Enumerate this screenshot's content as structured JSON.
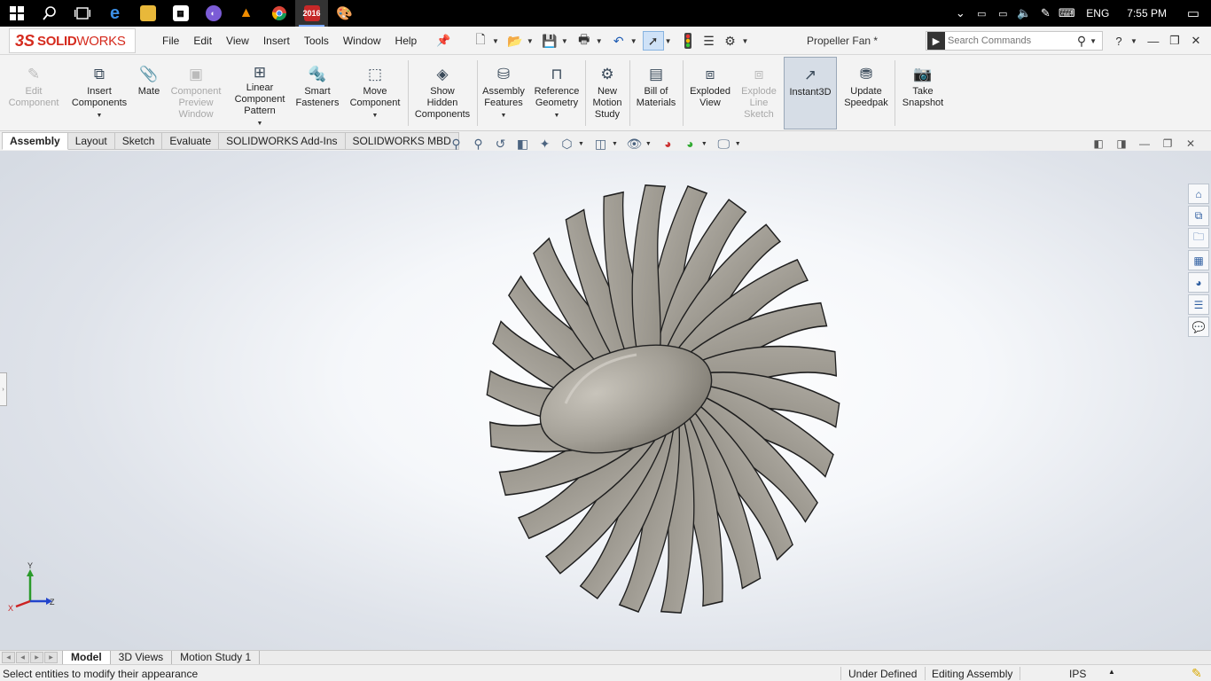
{
  "taskbar": {
    "icons": [
      "windows-start-icon",
      "search-icon",
      "task-view-icon",
      "edge-icon",
      "file-explorer-icon",
      "store-icon",
      "app-icon",
      "vlc-icon",
      "chrome-icon",
      "solidworks-2016-icon",
      "paint-icon"
    ],
    "solidworks_badge": "2016",
    "tray": {
      "language": "ENG",
      "time": "7:55 PM"
    }
  },
  "app": {
    "brand_ds": "3S",
    "brand_solid": "SOLID",
    "brand_works": "WORKS",
    "menus": [
      "File",
      "Edit",
      "View",
      "Insert",
      "Tools",
      "Window",
      "Help"
    ],
    "document_title": "Propeller Fan *",
    "search": {
      "placeholder": "Search Commands",
      "value": ""
    },
    "help_label": "?"
  },
  "command_manager": [
    {
      "id": "edit-component",
      "label": "Edit\nComponent",
      "icon": "edit-component-icon",
      "disabled": true
    },
    {
      "id": "insert-components",
      "label": "Insert\nComponents",
      "icon": "insert-components-icon",
      "dropdown": true
    },
    {
      "id": "mate",
      "label": "Mate",
      "icon": "mate-paperclip-icon"
    },
    {
      "id": "component-preview-window",
      "label": "Component\nPreview\nWindow",
      "icon": "preview-window-icon",
      "disabled": true
    },
    {
      "id": "linear-component-pattern",
      "label": "Linear\nComponent\nPattern",
      "icon": "linear-pattern-icon",
      "dropdown": true
    },
    {
      "id": "smart-fasteners",
      "label": "Smart\nFasteners",
      "icon": "smart-fasteners-icon"
    },
    {
      "id": "move-component",
      "label": "Move\nComponent",
      "icon": "move-component-icon",
      "dropdown": true
    },
    {
      "id": "show-hidden-components",
      "label": "Show\nHidden\nComponents",
      "icon": "show-hidden-icon"
    },
    {
      "id": "assembly-features",
      "label": "Assembly\nFeatures",
      "icon": "assembly-features-icon",
      "dropdown": true
    },
    {
      "id": "reference-geometry",
      "label": "Reference\nGeometry",
      "icon": "reference-geometry-icon",
      "dropdown": true
    },
    {
      "id": "new-motion-study",
      "label": "New\nMotion\nStudy",
      "icon": "motion-study-icon"
    },
    {
      "id": "bill-of-materials",
      "label": "Bill of\nMaterials",
      "icon": "bill-of-materials-icon"
    },
    {
      "id": "exploded-view",
      "label": "Exploded\nView",
      "icon": "exploded-view-icon"
    },
    {
      "id": "explode-line-sketch",
      "label": "Explode\nLine\nSketch",
      "icon": "explode-line-sketch-icon",
      "disabled": true
    },
    {
      "id": "instant3d",
      "label": "Instant3D",
      "icon": "instant3d-icon",
      "pressed": true
    },
    {
      "id": "update-speedpak",
      "label": "Update\nSpeedpak",
      "icon": "speedpak-icon"
    },
    {
      "id": "take-snapshot",
      "label": "Take\nSnapshot",
      "icon": "camera-icon"
    }
  ],
  "tabs": [
    {
      "label": "Assembly",
      "active": true
    },
    {
      "label": "Layout"
    },
    {
      "label": "Sketch"
    },
    {
      "label": "Evaluate"
    },
    {
      "label": "SOLIDWORKS Add-Ins"
    },
    {
      "label": "SOLIDWORKS MBD"
    }
  ],
  "viewport": {
    "triad": {
      "y": "Y",
      "x": "X",
      "z": "Z"
    },
    "model_color": "#a09c94"
  },
  "bottom_tabs": [
    {
      "label": "Model",
      "active": true
    },
    {
      "label": "3D Views"
    },
    {
      "label": "Motion Study 1"
    }
  ],
  "status": {
    "message": "Select entities to modify their appearance",
    "definition": "Under Defined",
    "mode": "Editing Assembly",
    "units": "IPS"
  }
}
